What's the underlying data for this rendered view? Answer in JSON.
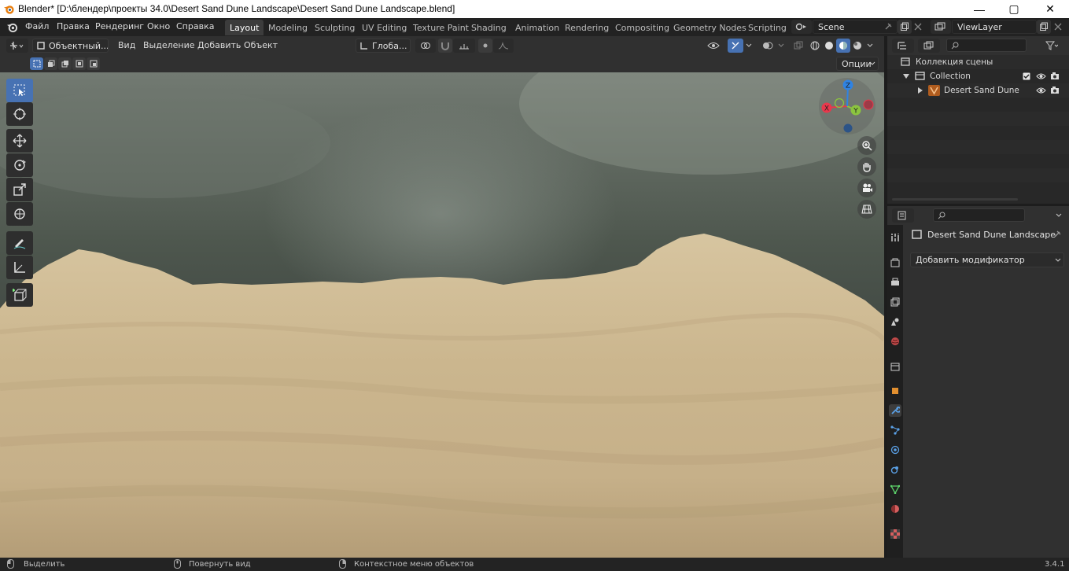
{
  "window": {
    "title": "Blender* [D:\\блендер\\проекты 34.0\\Desert Sand Dune Landscape\\Desert Sand Dune Landscape.blend]"
  },
  "menus": [
    "Файл",
    "Правка",
    "Рендеринг",
    "Окно",
    "Справка"
  ],
  "workspace_tabs": [
    {
      "label": "Layout",
      "active": true
    },
    {
      "label": "Modeling"
    },
    {
      "label": "Sculpting"
    },
    {
      "label": "UV Editing"
    },
    {
      "label": "Texture Paint"
    },
    {
      "label": "Shading"
    },
    {
      "label": "Animation"
    },
    {
      "label": "Rendering"
    },
    {
      "label": "Compositing"
    },
    {
      "label": "Geometry Nodes"
    },
    {
      "label": "Scripting"
    }
  ],
  "scene": {
    "name": "Scene"
  },
  "view_layer": {
    "name": "ViewLayer"
  },
  "viewport_header": {
    "mode": "Объектный...",
    "menus": [
      "Вид",
      "Выделение",
      "Добавить",
      "Объект"
    ],
    "transform_orientation": "Глоба..."
  },
  "viewport_options": "Опции",
  "gizmo": {
    "x": "X",
    "y": "Y",
    "z": "Z"
  },
  "outliner": {
    "scene_collection": "Коллекция сцены",
    "collection": "Collection",
    "object": "Desert Sand Dune Landscape"
  },
  "properties": {
    "object_name": "Desert Sand Dune Landscape",
    "add_modifier": "Добавить модификатор"
  },
  "status_bar": {
    "left_action": "Выделить",
    "middle_action": "Повернуть вид",
    "right_action": "Контекстное меню объектов",
    "version": "3.4.1"
  },
  "colors": {
    "accent": "#4772b3",
    "axis_x": "#e8384c",
    "axis_y": "#8bc43f",
    "axis_z": "#2f83e3",
    "sand": "#d4c09a"
  }
}
